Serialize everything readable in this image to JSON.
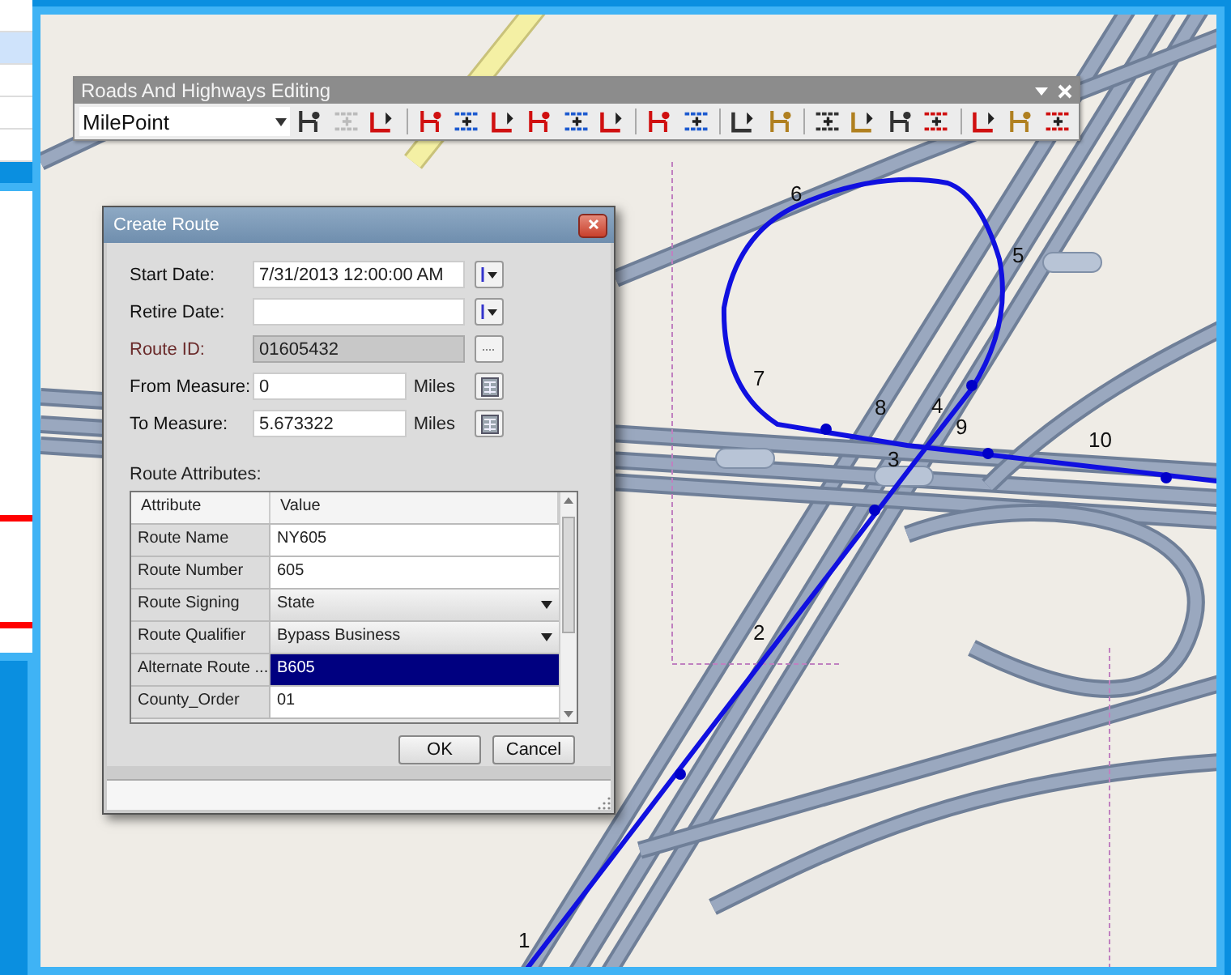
{
  "toolbar": {
    "title": "Roads And Highways Editing",
    "layer": "MilePoint",
    "tools": [
      {
        "disabled": false
      },
      {
        "disabled": true
      },
      {
        "disabled": false
      },
      {
        "disabled": false
      },
      {
        "disabled": false
      },
      {
        "disabled": false
      },
      {
        "disabled": false
      },
      {
        "disabled": false
      },
      {
        "disabled": false
      },
      {
        "disabled": false
      },
      {
        "disabled": false
      },
      {
        "disabled": false
      },
      {
        "disabled": false
      },
      {
        "disabled": false
      },
      {
        "disabled": false
      },
      {
        "disabled": false
      },
      {
        "disabled": false
      },
      {
        "disabled": false
      },
      {
        "disabled": false
      },
      {
        "disabled": false
      }
    ]
  },
  "dialog": {
    "title": "Create Route",
    "fields": [
      {
        "kind": "date",
        "label": "Start Date:",
        "value": "7/31/2013 12:00:00 AM",
        "disabled": false
      },
      {
        "kind": "date",
        "label": "Retire Date:",
        "disabled": false
      },
      {
        "kind": "picker",
        "label": "Route ID:",
        "value": "01605432",
        "disabled": true
      },
      {
        "kind": "measure",
        "label": "From Measure:",
        "value": "0",
        "unit": "Miles",
        "disabled": false
      },
      {
        "kind": "measure",
        "label": "To Measure:",
        "value": "5.673322",
        "unit": "Miles",
        "disabled": false
      }
    ],
    "attributes": {
      "label": "Route Attributes:",
      "columns": [
        "Attribute",
        "Value"
      ],
      "rows": [
        {
          "kind": "text",
          "attribute": "Route Name",
          "value": "NY605",
          "selected": false
        },
        {
          "kind": "text",
          "attribute": "Route Number",
          "value": "605",
          "selected": false
        },
        {
          "kind": "dropdown",
          "attribute": "Route Signing",
          "value": "State",
          "selected": false
        },
        {
          "kind": "dropdown",
          "attribute": "Route Qualifier",
          "value": "Bypass Business",
          "selected": false
        },
        {
          "kind": "text",
          "attribute": "Alternate Route ...",
          "value": "B605",
          "selected": true
        },
        {
          "kind": "text",
          "attribute": "County_Order",
          "value": "01",
          "selected": false
        }
      ]
    },
    "buttons": [
      "OK",
      "Cancel"
    ]
  },
  "map": {
    "route_labels": [
      "1",
      "2",
      "3",
      "4",
      "5",
      "6",
      "7",
      "8",
      "9",
      "10"
    ]
  }
}
